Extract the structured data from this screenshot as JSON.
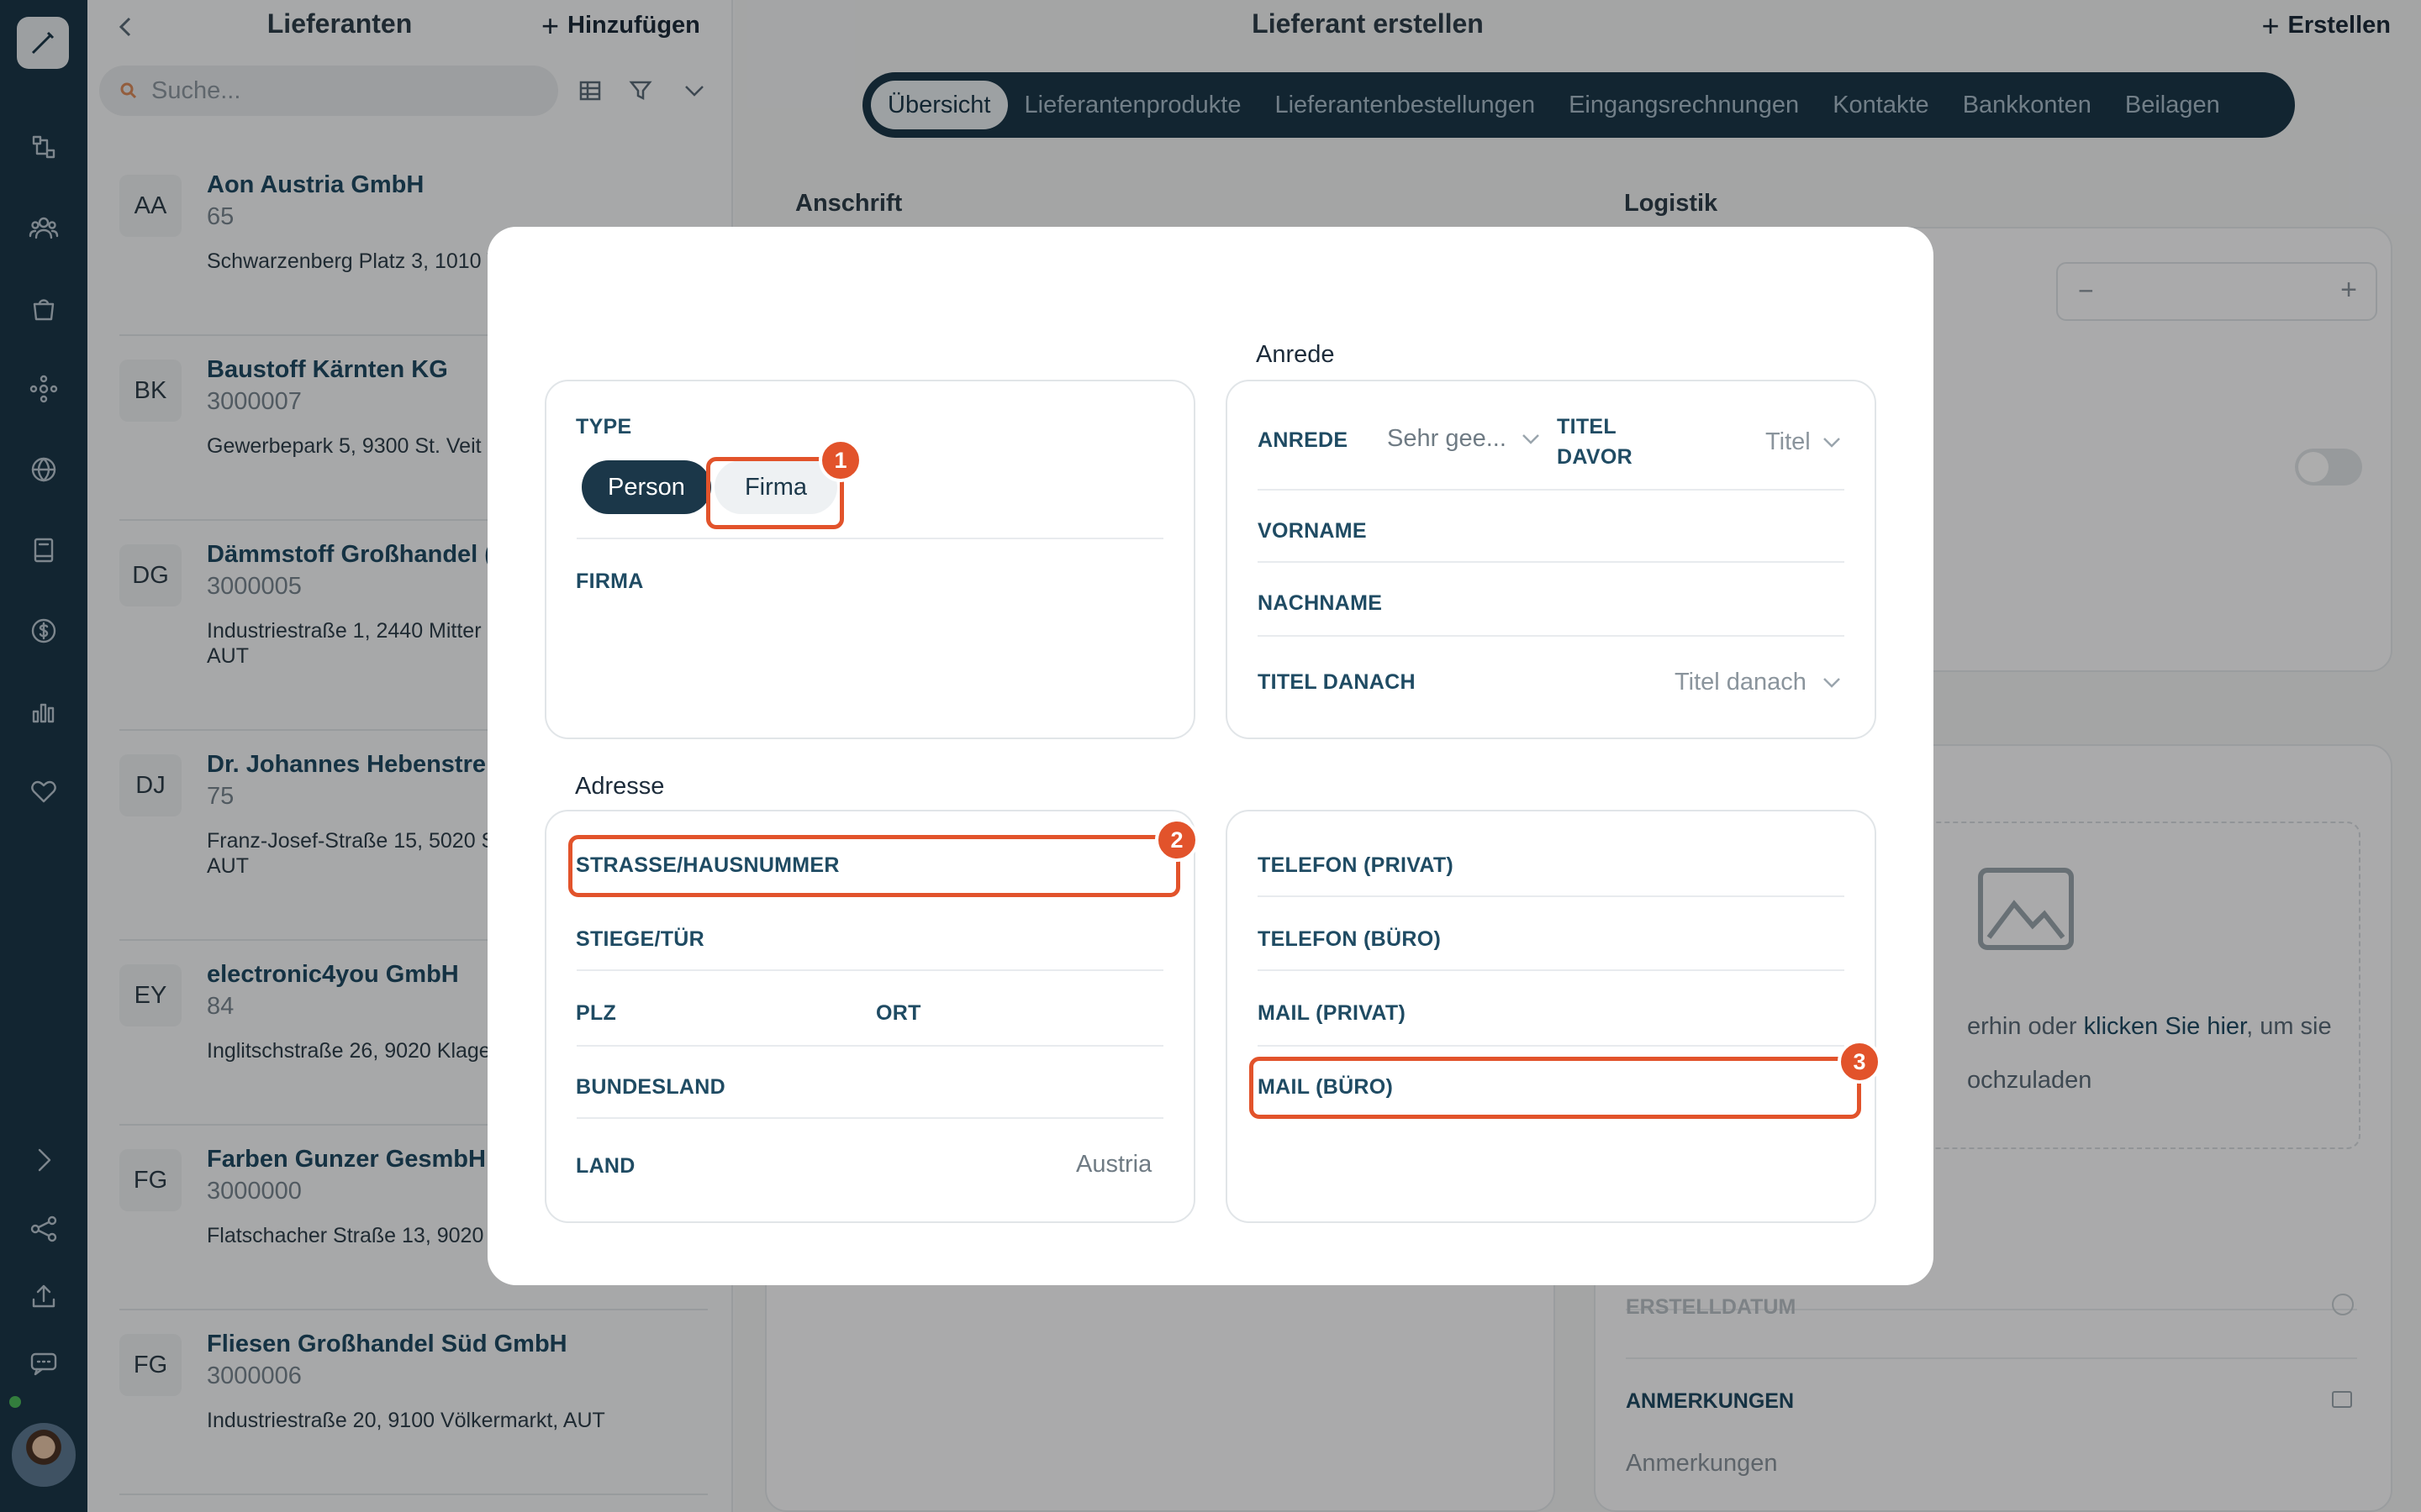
{
  "rail": {
    "icons": [
      "brush-icon",
      "workflow-icon",
      "users-icon",
      "shopping-bag-icon",
      "hub-icon",
      "globe-icon",
      "book-icon",
      "dollar-icon",
      "bar-chart-icon",
      "heart-icon",
      "chevron-right-icon",
      "share-icon",
      "upload-icon",
      "chat-icon"
    ]
  },
  "list": {
    "title": "Lieferanten",
    "add_label": "Hinzufügen",
    "search_placeholder": "Suche...",
    "items": [
      {
        "initials": "AA",
        "name": "Aon Austria GmbH",
        "number": "65",
        "address": "Schwarzenberg Platz 3, 1010 V"
      },
      {
        "initials": "BK",
        "name": "Baustoff Kärnten KG",
        "number": "3000007",
        "address": "Gewerbepark 5, 9300 St. Veit"
      },
      {
        "initials": "DG",
        "name": "Dämmstoff Großhandel (",
        "number": "3000005",
        "address": "Industriestraße 1, 2440 Mitter AUT"
      },
      {
        "initials": "DJ",
        "name": "Dr. Johannes Hebenstrei",
        "number": "75",
        "address": "Franz-Josef-Straße 15, 5020 S AUT"
      },
      {
        "initials": "EY",
        "name": "electronic4you GmbH",
        "number": "84",
        "address": "Inglitschstraße 26, 9020 Klage"
      },
      {
        "initials": "FG",
        "name": "Farben Gunzer GesmbH",
        "number": "3000000",
        "address": "Flatschacher Straße 13, 9020"
      },
      {
        "initials": "FG",
        "name": "Fliesen Großhandel Süd GmbH",
        "number": "3000006",
        "address": "Industriestraße 20, 9100 Völkermarkt, AUT"
      }
    ]
  },
  "main": {
    "title": "Lieferant erstellen",
    "create_label": "Erstellen",
    "tabs": [
      "Übersicht",
      "Lieferantenprodukte",
      "Lieferantenbestellungen",
      "Eingangsrechnungen",
      "Kontakte",
      "Bankkonten",
      "Beilagen"
    ],
    "active_tab": "Übersicht",
    "sections": {
      "left": "Anschrift",
      "right": "Logistik"
    },
    "upload_text_1": "erhin oder",
    "upload_link": "klicken Sie hier",
    "upload_text_2": ", um sie",
    "upload_text_3": "ochzuladen",
    "erstelldatum": "ERSTELLDATUM",
    "anmerkungen_label": "ANMERKUNGEN",
    "anmerkungen_placeholder": "Anmerkungen"
  },
  "modal": {
    "type_label": "TYPE",
    "type_options": [
      "Person",
      "Firma"
    ],
    "type_selected": "Person",
    "firma_label": "FIRMA",
    "anrede_heading": "Anrede",
    "anrede_label": "ANREDE",
    "anrede_value": "Sehr gee...",
    "titel_davor_label_1": "TITEL",
    "titel_davor_label_2": "DAVOR",
    "titel_davor_value": "Titel",
    "vorname_label": "VORNAME",
    "nachname_label": "NACHNAME",
    "titel_danach_label": "TITEL DANACH",
    "titel_danach_value": "Titel danach",
    "adresse_heading": "Adresse",
    "strasse_label": "STRASSE/HAUSNUMMER",
    "stiege_label": "STIEGE/TÜR",
    "plz_label": "PLZ",
    "ort_label": "ORT",
    "bundesland_label": "BUNDESLAND",
    "land_label": "LAND",
    "land_value": "Austria",
    "telefon_privat_label": "TELEFON (PRIVAT)",
    "telefon_buero_label": "TELEFON (BÜRO)",
    "mail_privat_label": "MAIL (PRIVAT)",
    "mail_buero_label": "MAIL (BÜRO)",
    "badges": [
      "1",
      "2",
      "3"
    ]
  },
  "colors": {
    "rail": "#1b3749",
    "accent": "#e2532b",
    "label": "#1f4b63"
  }
}
